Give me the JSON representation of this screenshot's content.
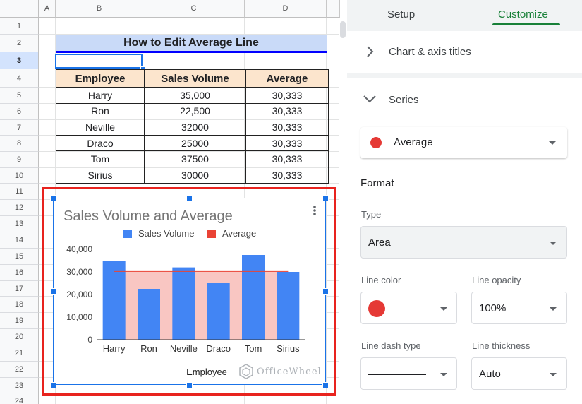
{
  "sheet": {
    "columns": [
      "A",
      "B",
      "C",
      "D"
    ],
    "rows": [
      "1",
      "2",
      "3",
      "4",
      "5",
      "6",
      "7",
      "8",
      "9",
      "10",
      "11",
      "12",
      "13",
      "14",
      "15",
      "16",
      "17",
      "18",
      "19",
      "20",
      "21",
      "22",
      "23",
      "24"
    ],
    "active_row": "3",
    "title": "How to Edit Average Line",
    "headers": [
      "Employee",
      "Sales Volume",
      "Average"
    ],
    "table": [
      [
        "Harry",
        "35,000",
        "30,333"
      ],
      [
        "Ron",
        "22,500",
        "30,333"
      ],
      [
        "Neville",
        "32000",
        "30,333"
      ],
      [
        "Draco",
        "25000",
        "30,333"
      ],
      [
        "Tom",
        "37500",
        "30,333"
      ],
      [
        "Sirius",
        "30000",
        "30,333"
      ]
    ]
  },
  "chart_data": {
    "type": "bar",
    "title": "Sales Volume and Average",
    "xlabel": "Employee",
    "ylabel": "",
    "categories": [
      "Harry",
      "Ron",
      "Neville",
      "Draco",
      "Tom",
      "Sirius"
    ],
    "series": [
      {
        "name": "Sales Volume",
        "type": "bar",
        "color": "#4285f4",
        "values": [
          35000,
          22500,
          32000,
          25000,
          37500,
          30000
        ]
      },
      {
        "name": "Average",
        "type": "area",
        "color": "#ea4335",
        "values": [
          30333,
          30333,
          30333,
          30333,
          30333,
          30333
        ]
      }
    ],
    "ylim": [
      0,
      40000
    ],
    "yticks": [
      "40,000",
      "30,000",
      "20,000",
      "10,000",
      "0"
    ],
    "yticks_values": [
      40000,
      30000,
      20000,
      10000,
      0
    ],
    "legend_position": "top",
    "grid": false
  },
  "watermark": "OfficeWheel",
  "panel": {
    "tabs": [
      "Setup",
      "Customize"
    ],
    "active_tab": "Customize",
    "chart_axis_titles": "Chart & axis titles",
    "series_title": "Series",
    "series_selected": "Average",
    "series_color": "#ea4335",
    "format_title": "Format",
    "type_label": "Type",
    "type_value": "Area",
    "line_color_label": "Line color",
    "line_color_value": "#e53935",
    "line_opacity_label": "Line opacity",
    "line_opacity_value": "100%",
    "line_dash_label": "Line dash type",
    "line_thickness_label": "Line thickness",
    "line_thickness_value": "Auto"
  }
}
